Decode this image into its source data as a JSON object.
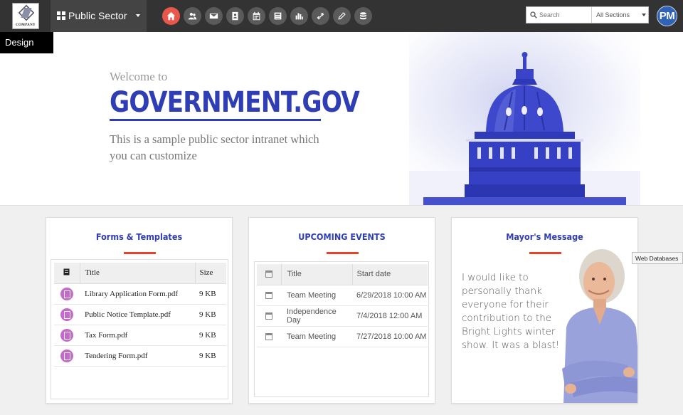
{
  "header": {
    "logo_text": "COMPANY",
    "site_name": "Public Sector",
    "nav_icons": [
      "home-icon",
      "people-icon",
      "mail-icon",
      "contacts-icon",
      "calendar-icon",
      "news-icon",
      "chart-icon",
      "links-icon",
      "pen-icon",
      "database-icon"
    ],
    "search_placeholder": "Search",
    "sections_label": "All Sections",
    "avatar_initials": "PM"
  },
  "design_tab": "Design",
  "hero": {
    "welcome": "Welcome to",
    "brand": "GOVERNMENT.GOV",
    "tagline": "This is a sample public sector intranet which you can customize"
  },
  "forms": {
    "title": "Forms & Templates",
    "columns": [
      "Title",
      "Size"
    ],
    "rows": [
      {
        "title": "Library Application Form.pdf",
        "size": "9 KB"
      },
      {
        "title": "Public Notice Template.pdf",
        "size": "9 KB"
      },
      {
        "title": "Tax Form.pdf",
        "size": "9 KB"
      },
      {
        "title": "Tendering Form.pdf",
        "size": "9 KB"
      }
    ]
  },
  "events": {
    "title": "UPCOMING EVENTS",
    "columns": [
      "Title",
      "Start date"
    ],
    "rows": [
      {
        "title": "Team Meeting",
        "date": "6/29/2018 10:00 AM"
      },
      {
        "title": "Independence Day",
        "date": "7/4/2018 12:00 AM"
      },
      {
        "title": "Team Meeting",
        "date": "7/27/2018 10:00 AM"
      }
    ]
  },
  "mayor": {
    "title": "Mayor's Message",
    "message": "I would like to personally thank everyone for their contribution to the Bright Lights winter show. It was a blast!"
  },
  "tooltip": "Web Databases",
  "colors": {
    "accent": "#2f3eb5",
    "active_nav": "#e8574a",
    "rule": "#e8412c",
    "pdf": "#c46acb"
  }
}
